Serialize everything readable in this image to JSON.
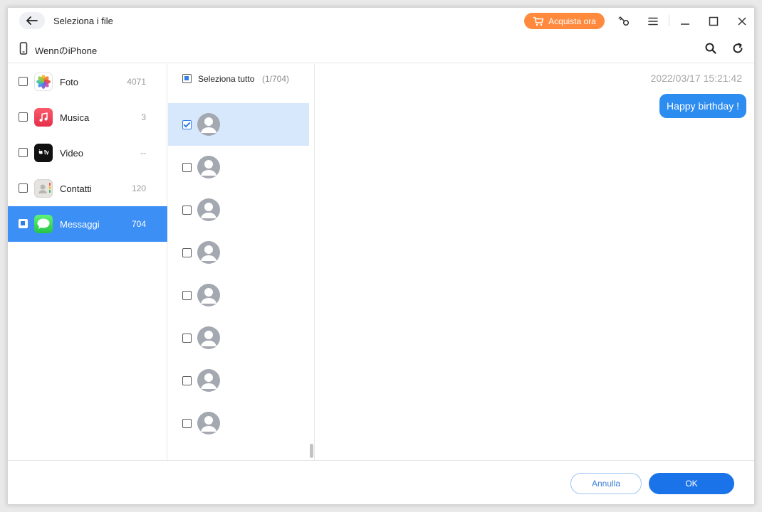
{
  "window": {
    "title": "Seleziona i file",
    "buy_label": "Acquista ora"
  },
  "device": {
    "name": "WennのiPhone"
  },
  "categories": [
    {
      "label": "Foto",
      "count": "4071",
      "icon": "photos-icon",
      "checked": false
    },
    {
      "label": "Musica",
      "count": "3",
      "icon": "music-icon",
      "checked": false
    },
    {
      "label": "Video",
      "count": "--",
      "icon": "tv-icon",
      "checked": false
    },
    {
      "label": "Contatti",
      "count": "120",
      "icon": "contacts-icon",
      "checked": false
    },
    {
      "label": "Messaggi",
      "count": "704",
      "icon": "messages-icon",
      "checked": "partial",
      "active": true
    }
  ],
  "list": {
    "select_all_label": "Seleziona tutto",
    "select_all_count": "(1/704)",
    "conversations": [
      {
        "checked": true,
        "active": true
      },
      {
        "checked": false
      },
      {
        "checked": false
      },
      {
        "checked": false
      },
      {
        "checked": false
      },
      {
        "checked": false
      },
      {
        "checked": false
      },
      {
        "checked": false
      }
    ]
  },
  "preview": {
    "timestamp": "2022/03/17 15:21:42",
    "message": "Happy birthday !"
  },
  "footer": {
    "cancel_label": "Annulla",
    "ok_label": "OK"
  },
  "colors": {
    "accent": "#3c8ff5",
    "buy": "#ff8a3d",
    "bubble": "#2d8cf0",
    "ok": "#1a73e8"
  }
}
